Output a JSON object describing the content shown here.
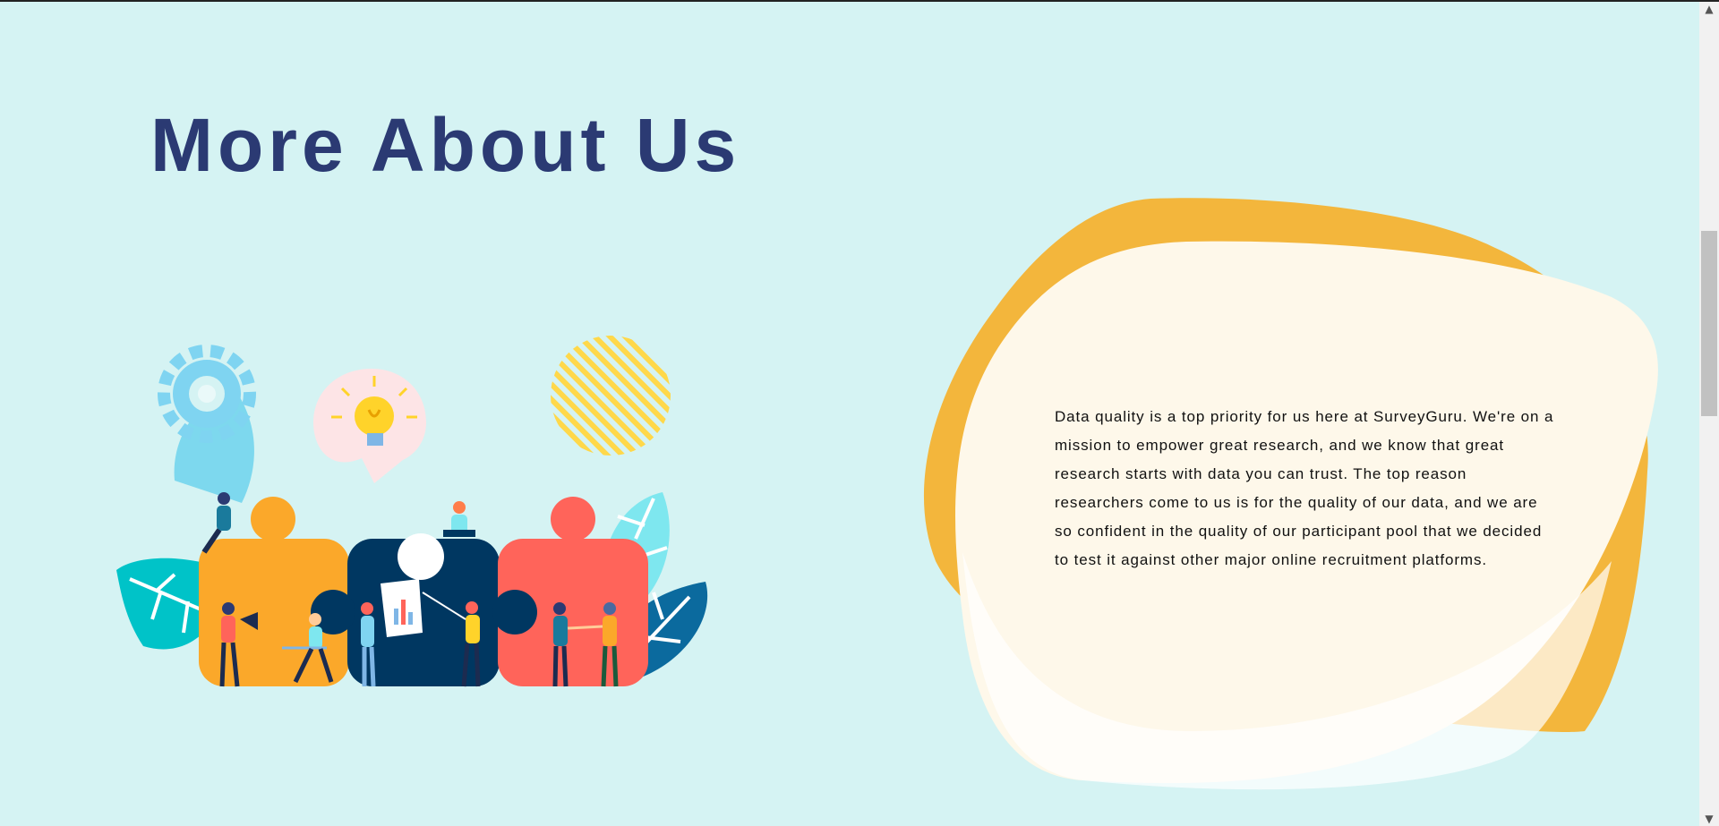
{
  "section": {
    "heading": "More About Us",
    "paragraph": "Data quality is a top priority for us here at SurveyGuru. We're on a mission to empower great research, and we know that great research starts with data you can trust. The top reason researchers come to us is for the quality of our data, and we are so confident in the quality of our participant pool that we decided to test it against other major online recruitment platforms."
  },
  "colors": {
    "background": "#d5f3f3",
    "heading": "#2b3a73",
    "blob_orange": "#f3b63c",
    "blob_cream": "#fef8ea",
    "puzzle_orange": "#fba82a",
    "puzzle_navy": "#003761",
    "puzzle_red": "#ff645a"
  },
  "illustration": {
    "icons": [
      "gear-icon",
      "lightbulb-icon",
      "striped-circle-icon",
      "leaf-icon",
      "puzzle-icon",
      "person-icon"
    ]
  },
  "scrollbar": {
    "up_icon": "chevron-up-icon",
    "down_icon": "chevron-down-icon"
  }
}
